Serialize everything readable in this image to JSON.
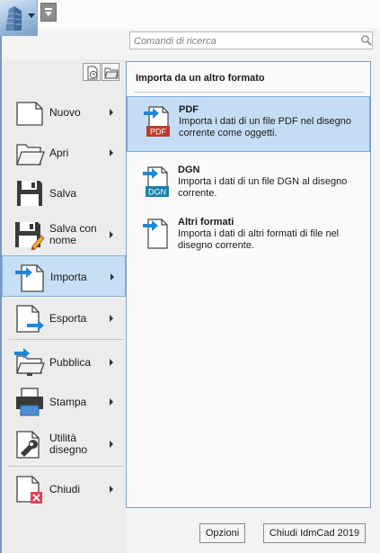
{
  "search": {
    "placeholder": "Comandi di ricerca"
  },
  "menu": {
    "items": [
      {
        "label": "Nuovo",
        "icon": "new-document-icon",
        "has_submenu": true
      },
      {
        "label": "Apri",
        "icon": "open-folder-icon",
        "has_submenu": true
      },
      {
        "label": "Salva",
        "icon": "save-disk-icon",
        "has_submenu": false
      },
      {
        "label": "Salva con nome",
        "icon": "save-as-icon",
        "has_submenu": true
      },
      {
        "label": "Importa",
        "icon": "import-icon",
        "has_submenu": true,
        "selected": true
      },
      {
        "label": "Esporta",
        "icon": "export-icon",
        "has_submenu": true
      },
      {
        "label": "Pubblica",
        "icon": "publish-icon",
        "has_submenu": true
      },
      {
        "label": "Stampa",
        "icon": "printer-icon",
        "has_submenu": true
      },
      {
        "label": "Utilità disegno",
        "icon": "wrench-icon",
        "has_submenu": true
      },
      {
        "label": "Chiudi",
        "icon": "close-document-icon",
        "has_submenu": true
      }
    ]
  },
  "submenu": {
    "title": "Importa da un altro formato",
    "items": [
      {
        "title": "PDF",
        "description": "Importa i dati di un file PDF nel disegno corrente come oggetti.",
        "icon": "pdf-import-icon",
        "badge": "PDF",
        "selected": true
      },
      {
        "title": "DGN",
        "description": "Importa i dati di un file DGN al disegno corrente.",
        "icon": "dgn-import-icon",
        "badge": "DGN"
      },
      {
        "title": "Altri formati",
        "description": "Importa i dati di altri formati di file nel disegno corrente.",
        "icon": "other-formats-import-icon"
      }
    ]
  },
  "footer": {
    "options_label": "Opzioni",
    "close_label": "Chiudi IdmCad 2019"
  },
  "colors": {
    "selection_fill": "#c5ddf4",
    "selection_border": "#79aadb",
    "arrow_blue": "#1e88d8",
    "pdf_red": "#c0392b",
    "dgn_teal": "#1a7fa8"
  }
}
